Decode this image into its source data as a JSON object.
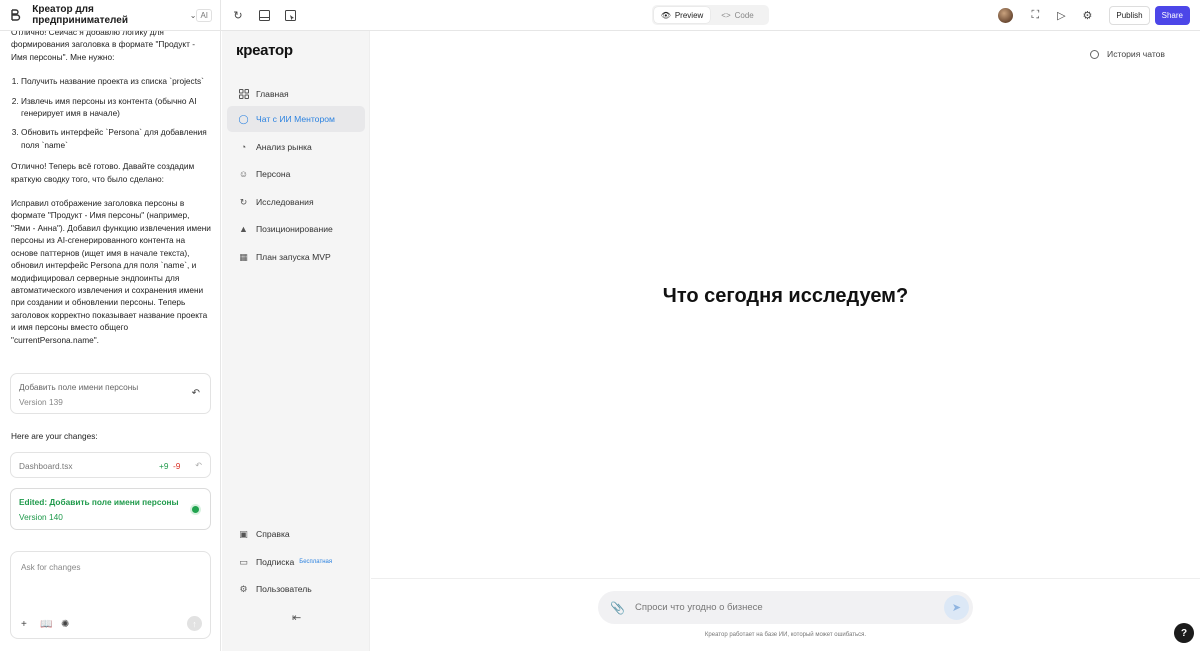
{
  "topbar": {
    "project_name": "Креатор для предпринимателей",
    "ai_badge": "AI",
    "preview_label": "Preview",
    "code_label": "Code",
    "publish_label": "Publish",
    "share_label": "Share"
  },
  "chat": {
    "intro": "Отлично! Сейчас я добавлю логику для формирования заголовка в формате \"Продукт - Имя персоны\". Мне нужно:",
    "steps": [
      "Получить название проекта из списка `projects`",
      "Извлечь имя персоны из контента (обычно AI генерирует имя в начале)",
      "Обновить интерфейс `Persona` для добавления поля `name`"
    ],
    "summary_intro": "Отлично! Теперь всё готово. Давайте создадим краткую сводку того, что было сделано:",
    "summary": "Исправил отображение заголовка персоны в формате \"Продукт - Имя персоны\" (например, \"Ями - Анна\"). Добавил функцию извлечения имени персоны из AI-сгенерированного контента на основе паттернов (ищет имя в начале текста), обновил интерфейс Persona для поля `name`, и модифицировал серверные эндпоинты для автоматического извлечения и сохранения имени при создании и обновлении персоны. Теперь заголовок корректно показывает название проекта и имя персоны вместо общего \"currentPersona.name\".",
    "version_card_1": {
      "title": "Добавить поле имени персоны",
      "version": "Version 139"
    },
    "changes_label": "Here are your changes:",
    "file_change": {
      "file": "Dashboard.tsx",
      "added": "+9",
      "removed": "-9"
    },
    "version_card_2": {
      "title": "Edited: Добавить поле имени персоны",
      "version": "Version 140"
    },
    "input_placeholder": "Ask for changes"
  },
  "app": {
    "brand": "креатор",
    "nav": [
      {
        "label": "Главная",
        "icon": "grid-icon"
      },
      {
        "label": "Чат с ИИ Ментором",
        "icon": "chat-icon",
        "active": true
      },
      {
        "label": "Анализ рынка",
        "icon": "pie-chart-icon"
      },
      {
        "label": "Персона",
        "icon": "user-circle-icon"
      },
      {
        "label": "Исследования",
        "icon": "refresh-icon"
      },
      {
        "label": "Позиционирование",
        "icon": "hierarchy-icon"
      },
      {
        "label": "План запуска MVP",
        "icon": "board-icon"
      }
    ],
    "bottom_nav": [
      {
        "label": "Справка",
        "icon": "book-icon"
      },
      {
        "label": "Подписка",
        "icon": "card-icon",
        "badge": "Бесплатная"
      },
      {
        "label": "Пользователь",
        "icon": "gear-icon"
      }
    ]
  },
  "main": {
    "history_label": "История чатов",
    "hero_title": "Что сегодня исследуем?",
    "input_placeholder": "Спроси что угодно о бизнесе",
    "disclaimer": "Креатор работает на базе ИИ, который может ошибаться."
  },
  "colors": {
    "accent": "#2d83e0",
    "share": "#4c46e8",
    "success": "#1f9a4b",
    "danger": "#d93025"
  }
}
